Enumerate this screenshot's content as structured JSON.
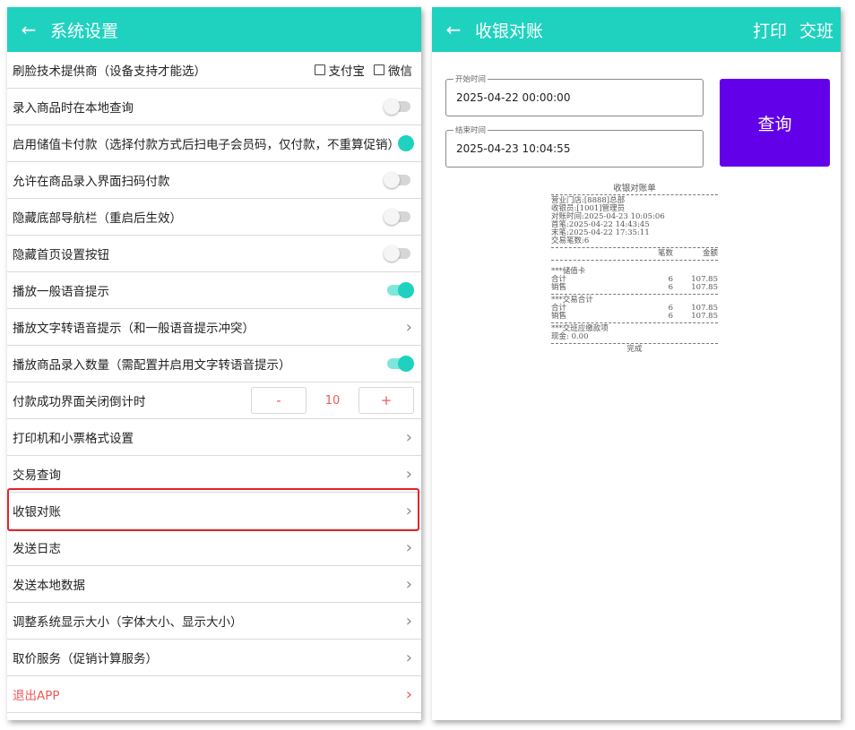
{
  "settings": {
    "title": "系统设置",
    "back_icon": "←",
    "face_provider_label": "刷脸技术提供商（设备支持才能选）",
    "alipay_label": "支付宝",
    "wechat_label": "微信",
    "rows": [
      {
        "label": "录入商品时在本地查询",
        "toggle": "off"
      },
      {
        "label": "启用储值卡付款（选择付款方式后扫电子会员码，仅付款，不重算促销）",
        "toggle": "on"
      },
      {
        "label": "允许在商品录入界面扫码付款",
        "toggle": "off"
      },
      {
        "label": "隐藏底部导航栏（重启后生效）",
        "toggle": "off"
      },
      {
        "label": "隐藏首页设置按钮",
        "toggle": "off"
      },
      {
        "label": "播放一般语音提示",
        "toggle": "on"
      },
      {
        "label": "播放文字转语音提示（和一般语音提示冲突）",
        "chevron": "›"
      },
      {
        "label": "播放商品录入数量（需配置并启用文字转语音提示）",
        "toggle": "on"
      }
    ],
    "countdown": {
      "label": "付款成功界面关闭倒计时",
      "minus": "-",
      "value": "10",
      "plus": "+"
    },
    "nav_rows": [
      {
        "label": "打印机和小票格式设置",
        "chevron": "›"
      },
      {
        "label": "交易查询",
        "chevron": "›"
      },
      {
        "label": "收银对账",
        "chevron": "›"
      },
      {
        "label": "发送日志",
        "chevron": "›"
      },
      {
        "label": "发送本地数据",
        "chevron": "›"
      },
      {
        "label": "调整系统显示大小（字体大小、显示大小）",
        "chevron": "›"
      },
      {
        "label": "取价服务（促销计算服务）",
        "chevron": "›"
      }
    ],
    "exit": {
      "label": "退出APP",
      "chevron": "›",
      "color": "#f0585a"
    }
  },
  "reconcile": {
    "title": "收银对账",
    "back_icon": "←",
    "print_label": "打印",
    "shift_label": "交班",
    "start_label": "开始时间",
    "start_value": "2025-04-22 00:00:00",
    "end_label": "结束时间",
    "end_value": "2025-04-23 10:04:55",
    "query_label": "查询"
  },
  "receipt": {
    "title": "收银对账单",
    "info": [
      "营业门店:[8888]总部",
      "收银员:[1001]管理员",
      "对账时间:2025-04-23 10:05:06",
      "首笔:2025-04-22 14:43:45",
      "末笔:2025-04-22 17:35:11",
      "交易笔数:6"
    ],
    "col_count": "笔数",
    "col_amount": "金额",
    "sections": [
      {
        "title": "***储值卡",
        "rows": [
          {
            "name": "合计",
            "count": "6",
            "amount": "107.85"
          },
          {
            "name": "销售",
            "count": "6",
            "amount": "107.85"
          }
        ]
      },
      {
        "title": "***交易合计",
        "rows": [
          {
            "name": "合计",
            "count": "6",
            "amount": "107.85"
          },
          {
            "name": "销售",
            "count": "6",
            "amount": "107.85"
          }
        ]
      }
    ],
    "payment_title": "***交班应缴款项",
    "cash": "现金: 0.00",
    "footer": "完成"
  },
  "colors": {
    "teal": "#1fd2bf",
    "purple": "#6200ea",
    "red": "#f0585a",
    "highlight": "#e5232c"
  }
}
